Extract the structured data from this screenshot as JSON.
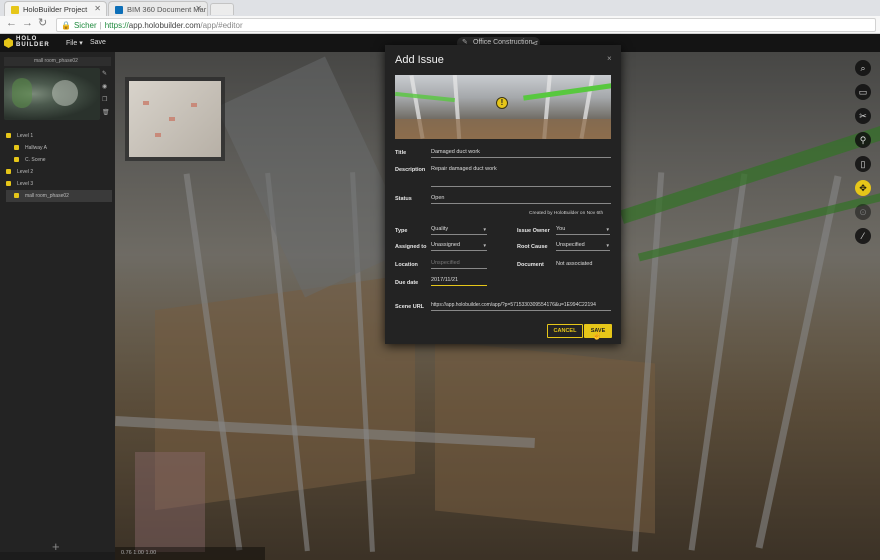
{
  "browser": {
    "tabs": [
      {
        "label": "HoloBuilder Project",
        "active": true
      },
      {
        "label": "BIM 360 Document Mar",
        "active": false
      }
    ],
    "address": {
      "security_label": "Sicher",
      "scheme": "https://",
      "host": "app.holobuilder.com",
      "path": "/app/#editor"
    }
  },
  "app": {
    "logo_text_top": "HOLO",
    "logo_text_bottom": "BUILDER",
    "menu_file": "File",
    "menu_save": "Save",
    "project_name": "Office Construction"
  },
  "sidebar": {
    "scene_name": "mall room_phase02",
    "tree": [
      {
        "label": "Level 1",
        "indent": 0
      },
      {
        "label": "Hallway A",
        "indent": 1
      },
      {
        "label": "C. Scene",
        "indent": 1
      },
      {
        "label": "Level 2",
        "indent": 0
      },
      {
        "label": "Level 3",
        "indent": 0
      },
      {
        "label": "mall room_phase02",
        "indent": 1,
        "selected": true
      }
    ],
    "add_label": "+"
  },
  "viewport": {
    "status_text": "0.76   1.00   1.00"
  },
  "modal": {
    "title": "Add Issue",
    "close_glyph": "×",
    "marker_glyph": "!",
    "fields": {
      "title_label": "Title",
      "title_value": "Damaged duct work",
      "description_label": "Description",
      "description_value": "Repair damaged duct work",
      "status_label": "Status",
      "status_value": "Open",
      "created_note": "Created by HoloBuilder on Nov 6th",
      "type_label": "Type",
      "type_value": "Quality",
      "issue_owner_label": "Issue Owner",
      "issue_owner_value": "You",
      "assigned_to_label": "Assigned to",
      "assigned_to_value": "Unassigned",
      "root_cause_label": "Root Cause",
      "root_cause_value": "Unspecified",
      "location_label": "Location",
      "location_placeholder": "Unspecified",
      "document_label": "Document",
      "document_value": "Not associated",
      "due_date_label": "Due date",
      "due_date_value": "2017/11/21",
      "scene_url_label": "Scene URL",
      "scene_url_value": "https://app.holobuilder.com/app/?p=5715330309554176&u=1E994C22194"
    },
    "cancel_label": "CANCEL",
    "save_label": "SAVE"
  },
  "colors": {
    "accent": "#e6c619",
    "modal_bg": "#232323",
    "pipe_green": "#4fb13a"
  }
}
